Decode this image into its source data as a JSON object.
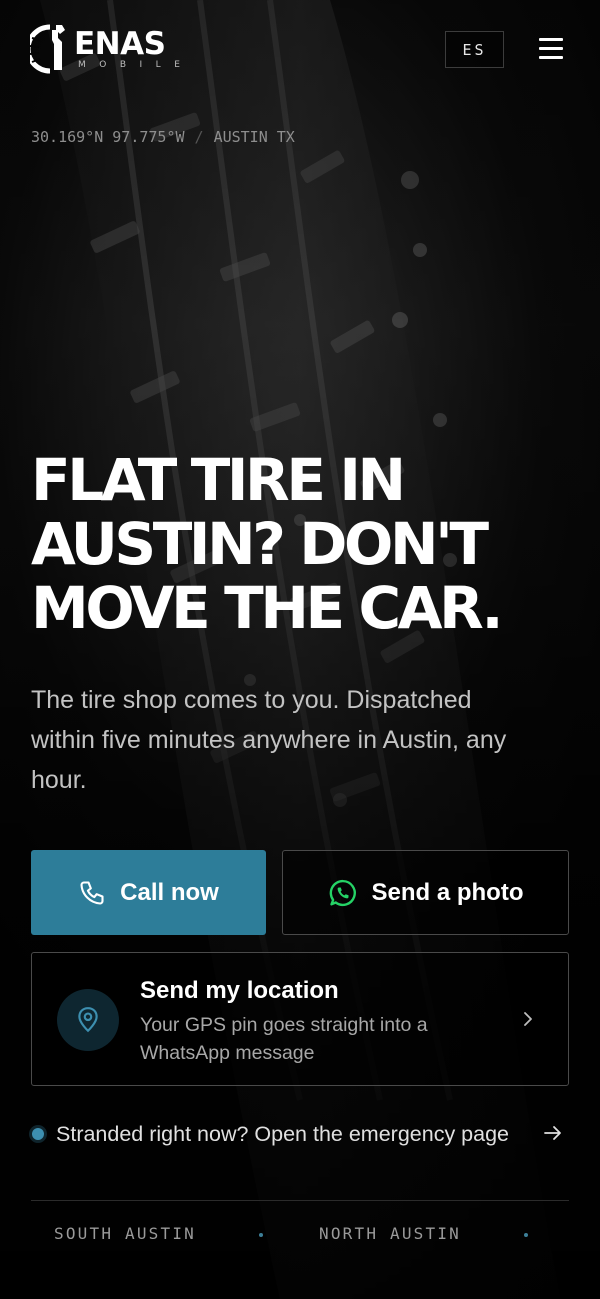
{
  "brand": {
    "name": "ENAS",
    "tagline": "MOBILE",
    "accent_color": "#2d7d99",
    "whatsapp_color": "#25d366"
  },
  "header": {
    "lang_label": "ES",
    "menu_icon": "hamburger-menu-icon"
  },
  "location_line": {
    "coords": "30.169°N 97.775°W",
    "separator": "/",
    "city": "AUSTIN TX"
  },
  "hero": {
    "headline_lines": [
      "FLAT TIRE IN",
      "AUSTIN? DON'T",
      "MOVE THE CAR."
    ],
    "subtext": "The tire shop comes to you. Dispatched within five minutes anywhere in Austin, any hour."
  },
  "actions": {
    "call_label": "Call now",
    "call_icon": "phone-icon",
    "photo_label": "Send a photo",
    "photo_icon": "whatsapp-icon"
  },
  "location_card": {
    "title": "Send my location",
    "description": "Your GPS pin goes straight into a WhatsApp message",
    "icon": "map-pin-icon"
  },
  "emergency": {
    "label": "Stranded right now? Open the emergency page",
    "icon": "arrow-right-icon"
  },
  "areas": [
    "SOUTH AUSTIN",
    "NORTH AUSTIN"
  ]
}
